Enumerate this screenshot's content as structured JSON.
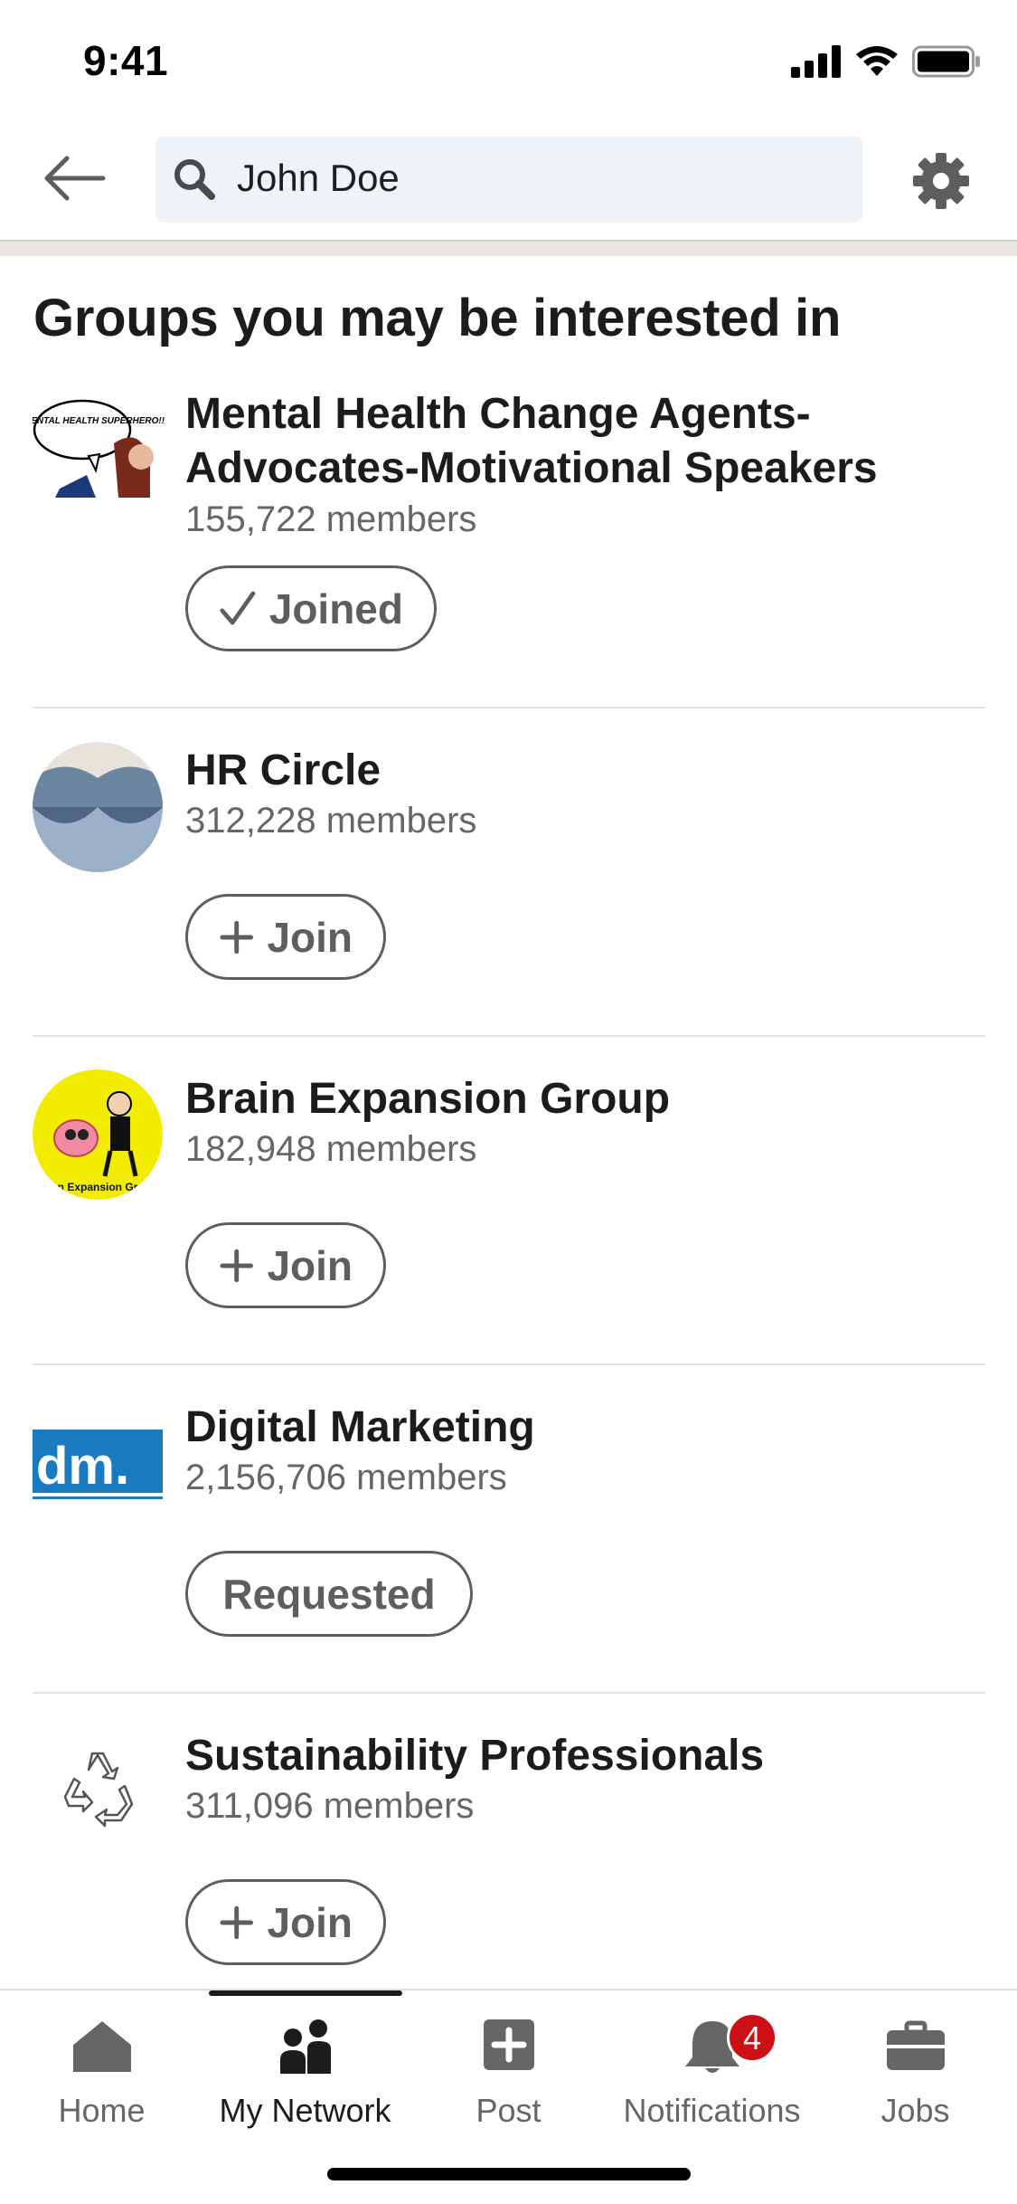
{
  "status_bar": {
    "time": "9:41"
  },
  "header": {
    "search_value": "John Doe"
  },
  "section": {
    "title": "Groups you may be interested in"
  },
  "groups": [
    {
      "name": "Mental Health Change Agents-Advocates-Motivational Speakers",
      "members": "155,722 members",
      "button": "Joined",
      "button_icon": "check-icon",
      "logo_text": "BE A MENTAL HEALTH SUPERHERO!!"
    },
    {
      "name": "HR Circle",
      "members": "312,228 members",
      "button": "Join",
      "button_icon": "plus-icon"
    },
    {
      "name": "Brain Expansion Group",
      "members": "182,948 members",
      "button": "Join",
      "button_icon": "plus-icon",
      "logo_text": "n Expansion Gr"
    },
    {
      "name": "Digital Marketing",
      "members": "2,156,706 members",
      "button": "Requested",
      "button_icon": "",
      "logo_text": "dm."
    },
    {
      "name": "Sustainability Professionals",
      "members": "311,096 members",
      "button": "Join",
      "button_icon": "plus-icon"
    }
  ],
  "bottom_nav": {
    "items": [
      {
        "label": "Home",
        "icon": "home-icon"
      },
      {
        "label": "My Network",
        "icon": "network-icon",
        "active": true
      },
      {
        "label": "Post",
        "icon": "post-icon"
      },
      {
        "label": "Notifications",
        "icon": "bell-icon",
        "badge": "4"
      },
      {
        "label": "Jobs",
        "icon": "briefcase-icon"
      }
    ]
  },
  "colors": {
    "badge": "#cc1016",
    "search_bg": "#eef3f8",
    "muted_text": "#666666",
    "brain_logo_bg": "#f2ec00",
    "dm_logo_blue": "#1a7bc0"
  }
}
